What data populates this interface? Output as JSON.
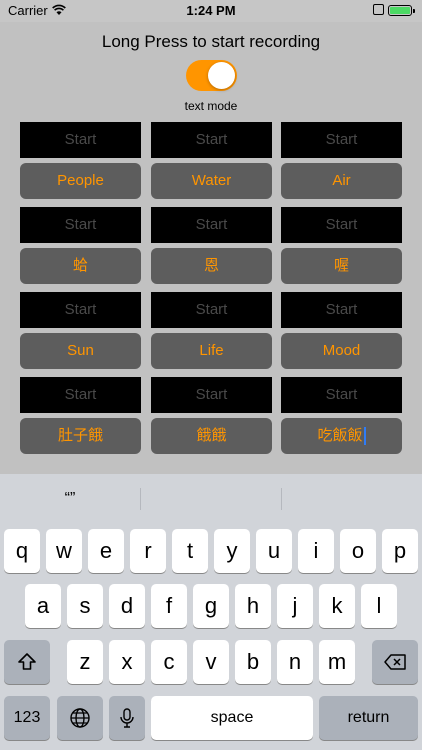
{
  "status": {
    "carrier": "Carrier",
    "time": "1:24 PM"
  },
  "app": {
    "title": "Long Press to start recording",
    "toggle_on": true,
    "mode_label": "text mode",
    "accent_color": "#ff9500",
    "start_label": "Start",
    "rows": [
      [
        "People",
        "Water",
        "Air"
      ],
      [
        "蛤",
        "恩",
        "喔"
      ],
      [
        "Sun",
        "Life",
        "Mood"
      ],
      [
        "肚子餓",
        "餓餓",
        "吃飯飯"
      ]
    ]
  },
  "keyboard": {
    "prediction": "“”",
    "row1": [
      "q",
      "w",
      "e",
      "r",
      "t",
      "y",
      "u",
      "i",
      "o",
      "p"
    ],
    "row2": [
      "a",
      "s",
      "d",
      "f",
      "g",
      "h",
      "j",
      "k",
      "l"
    ],
    "row3": [
      "z",
      "x",
      "c",
      "v",
      "b",
      "n",
      "m"
    ],
    "numbers_label": "123",
    "space_label": "space",
    "return_label": "return"
  }
}
